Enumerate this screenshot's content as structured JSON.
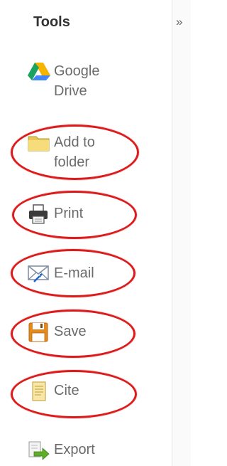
{
  "panel": {
    "title": "Tools",
    "collapse_glyph": "»"
  },
  "tools": [
    {
      "label": "Google Drive",
      "icon": "google-drive-icon"
    },
    {
      "label": "Add to folder",
      "icon": "folder-icon"
    },
    {
      "label": "Print",
      "icon": "printer-icon"
    },
    {
      "label": "E-mail",
      "icon": "email-icon"
    },
    {
      "label": "Save",
      "icon": "floppy-disk-icon"
    },
    {
      "label": "Cite",
      "icon": "document-icon"
    },
    {
      "label": "Export",
      "icon": "export-icon"
    }
  ],
  "colors": {
    "highlight_ring": "#dc1c1c",
    "label_text": "#6b6b6b"
  }
}
